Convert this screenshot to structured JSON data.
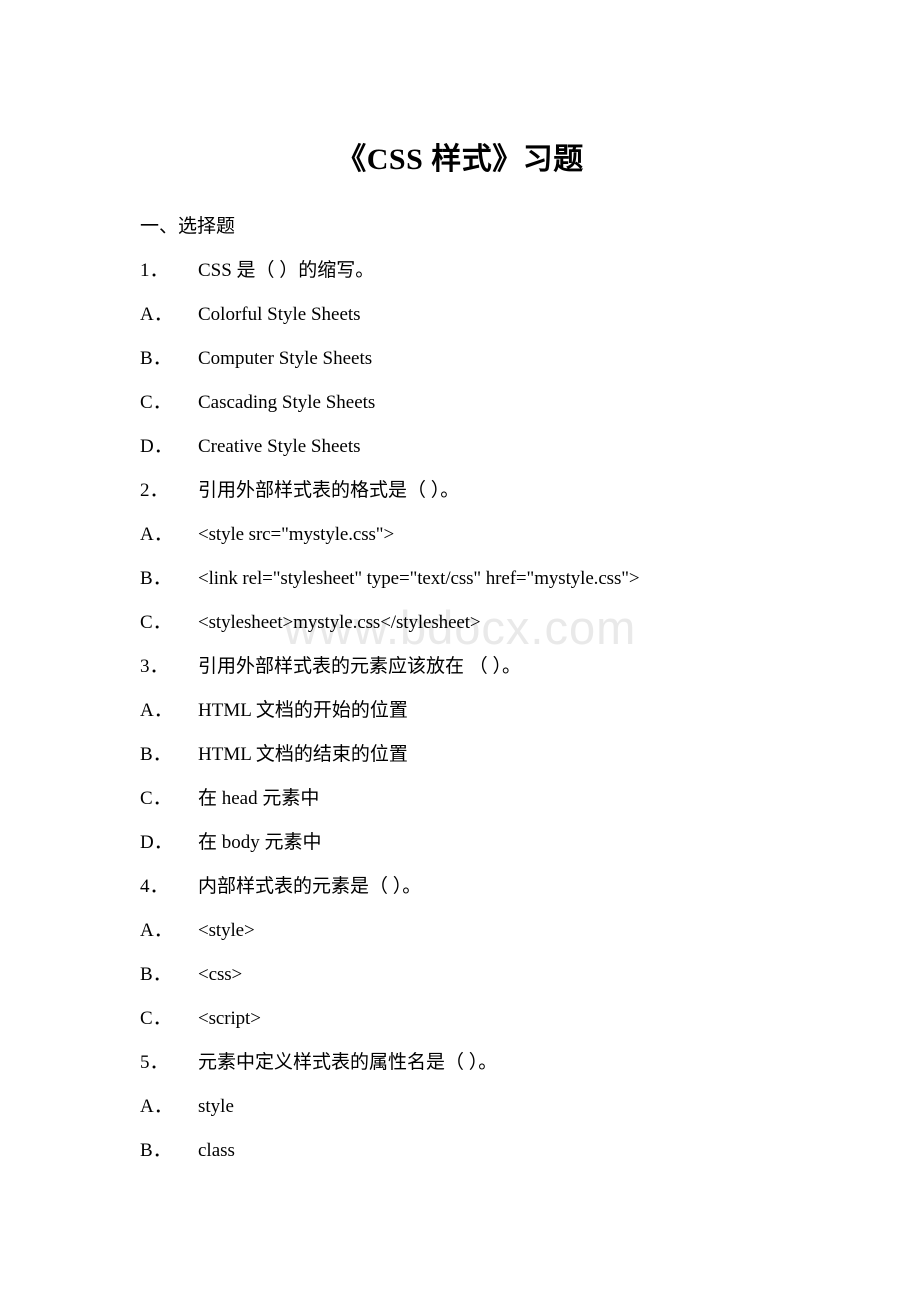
{
  "document": {
    "title": "《CSS 样式》习题",
    "watermark": "www.bdocx.com",
    "sections": [
      {
        "heading": "一、选择题",
        "questions": [
          {
            "number": "1．",
            "text": "CSS 是（ ）的缩写。",
            "options": [
              {
                "marker": "A．",
                "text": "Colorful Style Sheets"
              },
              {
                "marker": "B．",
                "text": "Computer Style Sheets"
              },
              {
                "marker": "C．",
                "text": "Cascading Style Sheets"
              },
              {
                "marker": "D．",
                "text": "Creative Style Sheets"
              }
            ]
          },
          {
            "number": "2．",
            "text": "引用外部样式表的格式是（ ）。",
            "options": [
              {
                "marker": "A．",
                "text": "<style src=\"mystyle.css\">"
              },
              {
                "marker": "B．",
                "text": "<link rel=\"stylesheet\" type=\"text/css\" href=\"mystyle.css\">"
              },
              {
                "marker": "C．",
                "text": "<stylesheet>mystyle.css</stylesheet>"
              }
            ]
          },
          {
            "number": "3．",
            "text": "引用外部样式表的元素应该放在 （ ）。",
            "options": [
              {
                "marker": "A．",
                "text": "HTML 文档的开始的位置"
              },
              {
                "marker": "B．",
                "text": "HTML 文档的结束的位置"
              },
              {
                "marker": "C．",
                "text": "在 head 元素中"
              },
              {
                "marker": "D．",
                "text": "在 body 元素中"
              }
            ]
          },
          {
            "number": "4．",
            "text": "内部样式表的元素是（ ）。",
            "options": [
              {
                "marker": "A．",
                "text": "<style>"
              },
              {
                "marker": "B．",
                "text": "<css>"
              },
              {
                "marker": "C．",
                "text": "<script>"
              }
            ]
          },
          {
            "number": "5．",
            "text": "元素中定义样式表的属性名是（ ）。",
            "options": [
              {
                "marker": "A．",
                "text": "style"
              },
              {
                "marker": "B．",
                "text": "class"
              }
            ]
          }
        ]
      }
    ]
  }
}
